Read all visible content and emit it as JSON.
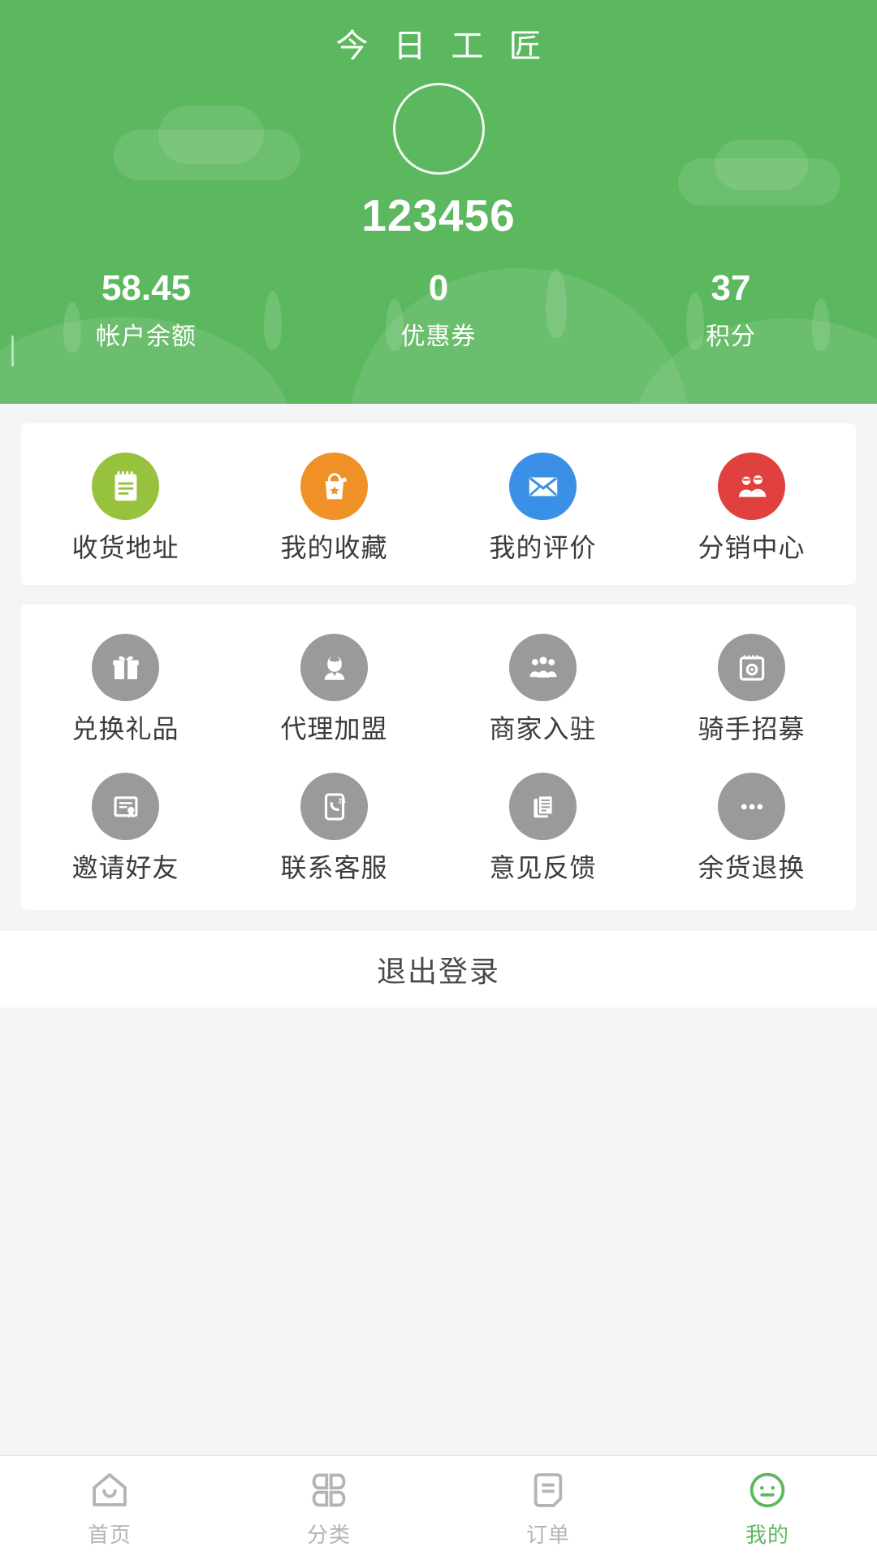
{
  "header": {
    "title": "今 日 工 匠",
    "avatar_icon": "avatar-placeholder-circle",
    "username": "123456",
    "stats": [
      {
        "value": "58.45",
        "label": "帐户余额"
      },
      {
        "value": "0",
        "label": "优惠券"
      },
      {
        "value": "37",
        "label": "积分"
      }
    ]
  },
  "colors": {
    "brand_green": "#5cb85f",
    "page_bg": "#f4f5f7",
    "card_bg": "#ffffff",
    "label_text": "#3b3b3b",
    "tab_inactive": "#b4b4b4",
    "tab_active": "#5cb85f",
    "icon_gray": "#9a9a9a",
    "icon_green": "#8dc githubsomething"
  },
  "primary_grid": {
    "items": [
      {
        "label": "收货地址",
        "icon": "notepad-icon",
        "color": "#97c23d"
      },
      {
        "label": "我的收藏",
        "icon": "shopping-bag-star-icon",
        "color": "#ef9126"
      },
      {
        "label": "我的评价",
        "icon": "envelope-icon",
        "color": "#3a8fe6"
      },
      {
        "label": "分销中心",
        "icon": "two-people-icon",
        "color": "#e0413f"
      }
    ]
  },
  "secondary_grid": {
    "icon_color": "#9a9a9a",
    "rows": [
      [
        {
          "label": "兑换礼品",
          "icon": "gift-box-icon"
        },
        {
          "label": "代理加盟",
          "icon": "agent-person-icon"
        },
        {
          "label": "商家入驻",
          "icon": "group-people-icon"
        },
        {
          "label": "骑手招募",
          "icon": "camera-badge-icon"
        }
      ],
      [
        {
          "label": "邀请好友",
          "icon": "certificate-icon"
        },
        {
          "label": "联系客服",
          "icon": "phone-24h-support-icon"
        },
        {
          "label": "意见反馈",
          "icon": "documents-icon"
        },
        {
          "label": "余货退换",
          "icon": "more-dots-icon"
        }
      ]
    ]
  },
  "logout": {
    "label": "退出登录"
  },
  "tabbar": {
    "tabs": [
      {
        "label": "首页",
        "icon": "home-icon",
        "active": false
      },
      {
        "label": "分类",
        "icon": "category-grid-icon",
        "active": false
      },
      {
        "label": "订单",
        "icon": "order-list-icon",
        "active": false
      },
      {
        "label": "我的",
        "icon": "smiley-face-icon",
        "active": true
      }
    ]
  }
}
